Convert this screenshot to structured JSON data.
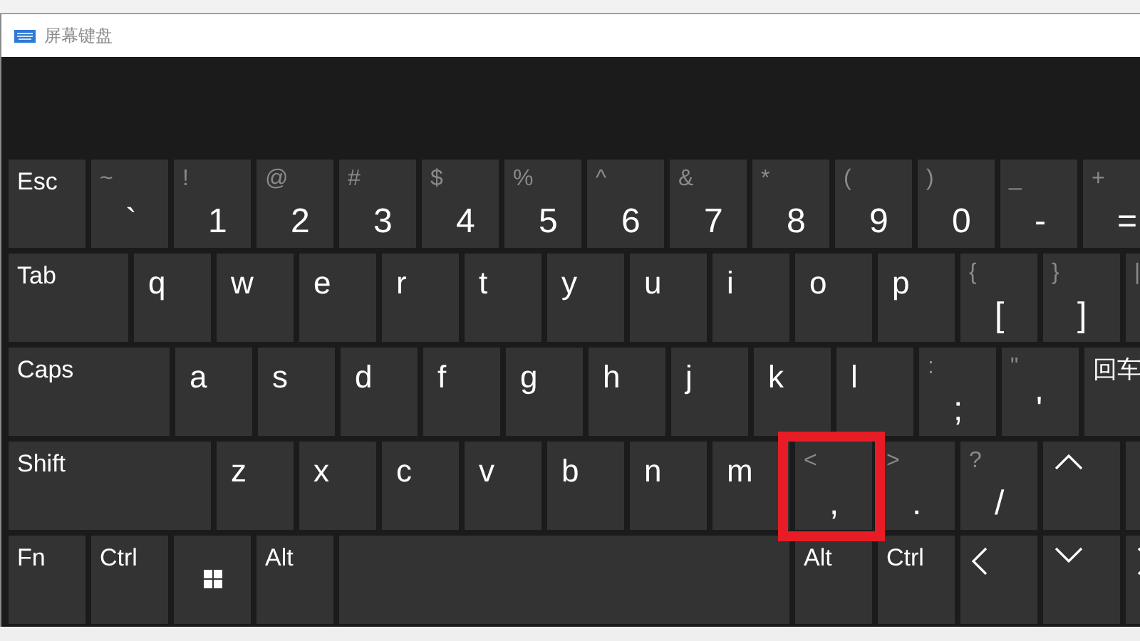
{
  "window": {
    "title": "屏幕键盘"
  },
  "keyboard": {
    "rows": [
      {
        "keys": [
          {
            "kind": "mod",
            "label": "Esc"
          },
          {
            "kind": "dual",
            "shift": "~",
            "label": "`"
          },
          {
            "kind": "dual",
            "shift": "!",
            "label": "1"
          },
          {
            "kind": "dual",
            "shift": "@",
            "label": "2"
          },
          {
            "kind": "dual",
            "shift": "#",
            "label": "3"
          },
          {
            "kind": "dual",
            "shift": "$",
            "label": "4"
          },
          {
            "kind": "dual",
            "shift": "%",
            "label": "5"
          },
          {
            "kind": "dual",
            "shift": "^",
            "label": "6"
          },
          {
            "kind": "dual",
            "shift": "&",
            "label": "7"
          },
          {
            "kind": "dual",
            "shift": "*",
            "label": "8"
          },
          {
            "kind": "dual",
            "shift": "(",
            "label": "9"
          },
          {
            "kind": "dual",
            "shift": ")",
            "label": "0"
          },
          {
            "kind": "dual",
            "shift": "_",
            "label": "-"
          },
          {
            "kind": "dual",
            "shift": "+",
            "label": "="
          }
        ]
      },
      {
        "keys": [
          {
            "kind": "tab",
            "label": "Tab"
          },
          {
            "kind": "letter",
            "label": "q"
          },
          {
            "kind": "letter",
            "label": "w"
          },
          {
            "kind": "letter",
            "label": "e"
          },
          {
            "kind": "letter",
            "label": "r"
          },
          {
            "kind": "letter",
            "label": "t"
          },
          {
            "kind": "letter",
            "label": "y"
          },
          {
            "kind": "letter",
            "label": "u"
          },
          {
            "kind": "letter",
            "label": "i"
          },
          {
            "kind": "letter",
            "label": "o"
          },
          {
            "kind": "letter",
            "label": "p"
          },
          {
            "kind": "dual",
            "shift": "{",
            "label": "["
          },
          {
            "kind": "dual",
            "shift": "}",
            "label": "]"
          },
          {
            "kind": "dual",
            "shift": "|"
          }
        ]
      },
      {
        "keys": [
          {
            "kind": "caps",
            "label": "Caps"
          },
          {
            "kind": "letter",
            "label": "a"
          },
          {
            "kind": "letter",
            "label": "s"
          },
          {
            "kind": "letter",
            "label": "d"
          },
          {
            "kind": "letter",
            "label": "f"
          },
          {
            "kind": "letter",
            "label": "g"
          },
          {
            "kind": "letter",
            "label": "h"
          },
          {
            "kind": "letter",
            "label": "j"
          },
          {
            "kind": "letter",
            "label": "k"
          },
          {
            "kind": "letter",
            "label": "l"
          },
          {
            "kind": "dual",
            "shift": ":",
            "label": ";"
          },
          {
            "kind": "dual",
            "shift": "\"",
            "label": "'"
          },
          {
            "kind": "mod",
            "label": "回车"
          }
        ]
      },
      {
        "keys": [
          {
            "kind": "shift",
            "label": "Shift"
          },
          {
            "kind": "letter",
            "label": "z"
          },
          {
            "kind": "letter",
            "label": "x"
          },
          {
            "kind": "letter",
            "label": "c"
          },
          {
            "kind": "letter",
            "label": "v"
          },
          {
            "kind": "letter",
            "label": "b"
          },
          {
            "kind": "letter",
            "label": "n"
          },
          {
            "kind": "letter",
            "label": "m"
          },
          {
            "kind": "dual",
            "shift": "<",
            "label": ",",
            "highlighted": true
          },
          {
            "kind": "dual",
            "shift": ">",
            "label": ".",
            "highlighted": false
          },
          {
            "kind": "dual",
            "shift": "?",
            "label": "/",
            "highlighted": false
          },
          {
            "kind": "up"
          },
          {
            "kind": "blank"
          }
        ]
      },
      {
        "keys": [
          {
            "kind": "mod",
            "label": "Fn"
          },
          {
            "kind": "mod",
            "label": "Ctrl"
          },
          {
            "kind": "windows"
          },
          {
            "kind": "mod",
            "label": "Alt"
          },
          {
            "kind": "space"
          },
          {
            "kind": "mod",
            "label": "Alt"
          },
          {
            "kind": "mod",
            "label": "Ctrl"
          },
          {
            "kind": "left"
          },
          {
            "kind": "down"
          },
          {
            "kind": "right"
          }
        ]
      }
    ]
  }
}
